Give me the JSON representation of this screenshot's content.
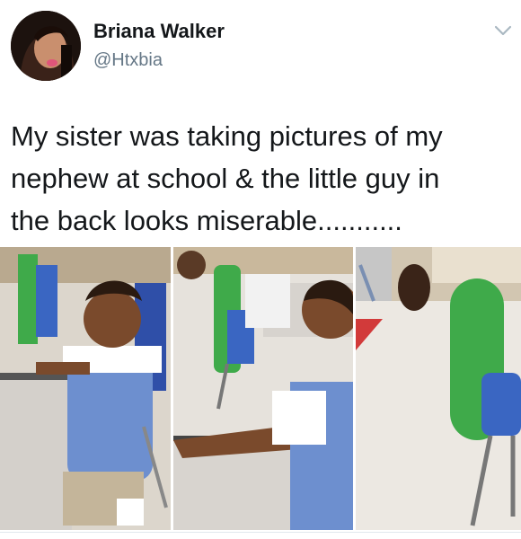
{
  "user": {
    "name": "Briana Walker",
    "handle": "@Htxbia"
  },
  "tweet": {
    "lines": [
      "My sister was taking pictures of my",
      "nephew at school & the little guy in",
      "the back looks miserable..........."
    ]
  },
  "icons": {
    "menu": "chevron-down-icon"
  },
  "colors": {
    "handle": "#657786",
    "chevron": "#aab8c2"
  }
}
